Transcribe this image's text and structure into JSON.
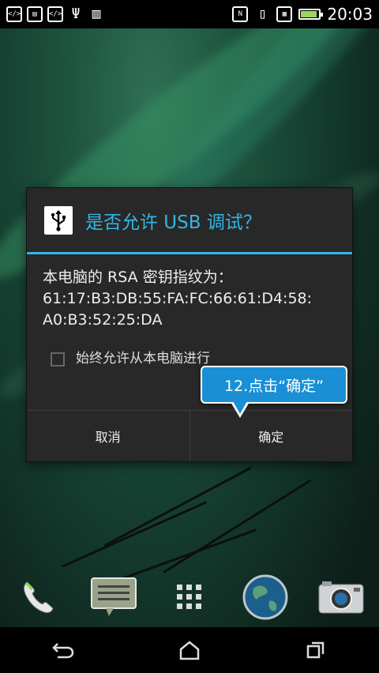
{
  "status_bar": {
    "left_icons": [
      "code-icon",
      "keyboard-icon",
      "code-icon",
      "usb-icon",
      "barcode-icon"
    ],
    "right_icons": [
      "nfc-icon",
      "vibrate-icon",
      "sim-icon",
      "battery-charging-icon"
    ],
    "time": "20:03",
    "battery_level": 0.8
  },
  "dialog": {
    "title": "是否允许 USB 调试？",
    "body_line1": "本电脑的 RSA 密钥指纹为：",
    "body_line2": "61:17:B3:DB:55:FA:FC:66:61:D4:58:",
    "body_line3": "A0:B3:52:25:DA",
    "checkbox_label": "始终允许从本电脑进行",
    "checkbox_checked": false,
    "cancel_label": "取消",
    "ok_label": "确定",
    "accent_color": "#33b5e5"
  },
  "callout": {
    "text": "12.点击“确定”",
    "color": "#1a8fd6"
  },
  "dock": {
    "items": [
      "phone-icon",
      "messages-icon",
      "app-drawer-icon",
      "browser-globe-icon",
      "camera-icon"
    ]
  },
  "nav_bar": {
    "buttons": [
      "back-icon",
      "home-icon",
      "recents-icon"
    ]
  }
}
